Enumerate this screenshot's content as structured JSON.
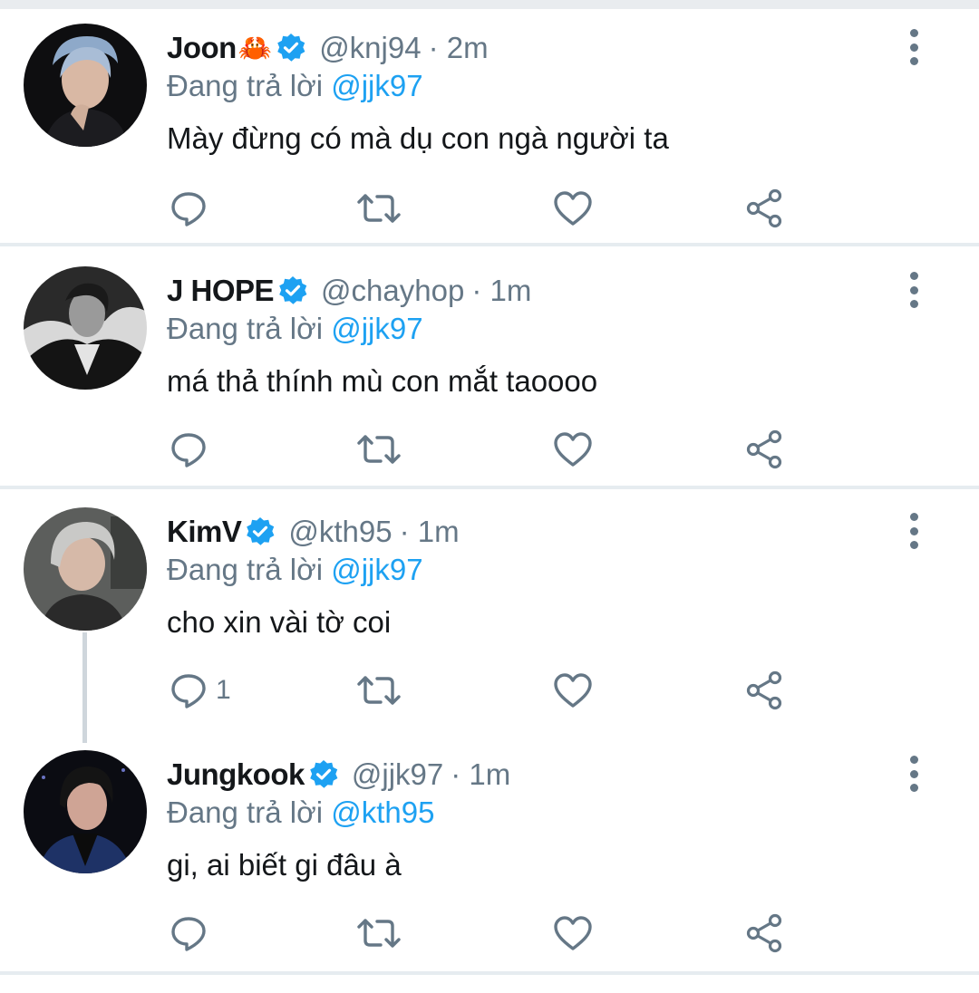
{
  "tweets": [
    {
      "name": "Joon",
      "name_emoji": "🦀",
      "handle": "@knj94",
      "time": "· 2m",
      "replying_prefix": "Đang trả lời",
      "replying_to": "@jjk97",
      "text": "Mày đừng có mà dụ con ngà người ta",
      "reply_count": ""
    },
    {
      "name": "J HOPE",
      "handle": "@chayhop",
      "time": "· 1m",
      "replying_prefix": "Đang trả lời",
      "replying_to": "@jjk97",
      "text": "má thả thính mù con mắt taoooo",
      "reply_count": ""
    },
    {
      "name": "KimV",
      "handle": "@kth95",
      "time": "· 1m",
      "replying_prefix": "Đang trả lời",
      "replying_to": "@jjk97",
      "text": "cho xin vài tờ coi",
      "reply_count": "1"
    },
    {
      "name": "Jungkook",
      "handle": "@jjk97",
      "time": "· 1m",
      "replying_prefix": "Đang trả lời",
      "replying_to": "@kth95",
      "text": "gi, ai biết gi đâu à",
      "reply_count": ""
    }
  ],
  "icons": {
    "reply": "reply-icon",
    "retweet": "retweet-icon",
    "like": "heart-icon",
    "share": "share-icon",
    "more": "more-vertical-icon",
    "verified": "verified-badge-icon"
  },
  "colors": {
    "link": "#1da1f2",
    "secondary": "#657786",
    "text": "#14171a",
    "divider": "#e6ecf0"
  }
}
